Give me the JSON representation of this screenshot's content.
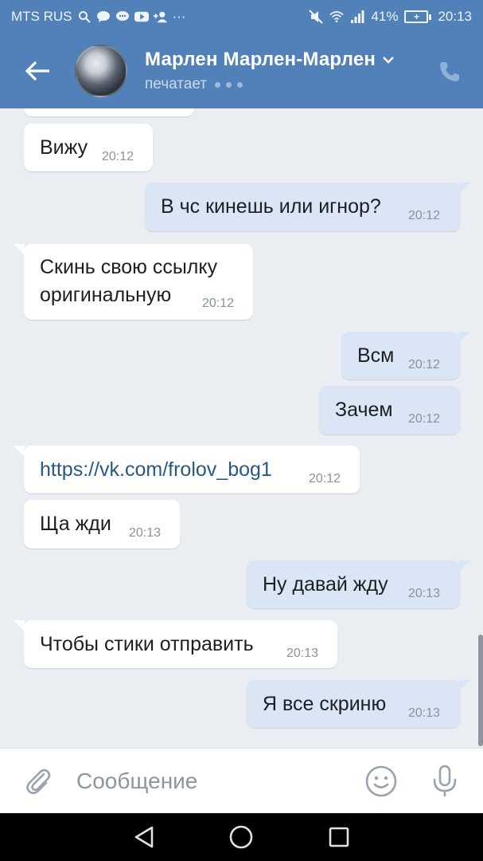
{
  "statusbar": {
    "carrier": "MTS RUS",
    "battery_percent": "41%",
    "battery_level": "+",
    "time": "20:13"
  },
  "header": {
    "name": "Марлен Марлен-Марлен",
    "status": "печатает"
  },
  "messages": [
    {
      "dir": "in",
      "text": "Вижу",
      "time": "20:12"
    },
    {
      "dir": "out",
      "text": "В чс кинешь или игнор?",
      "time": "20:12"
    },
    {
      "dir": "in",
      "line1": "Скинь свою ссылку",
      "line2": "оригинальную",
      "time": "20:12"
    },
    {
      "dir": "out",
      "text": "Всм",
      "time": "20:12"
    },
    {
      "dir": "out",
      "text": "Зачем",
      "time": "20:12"
    },
    {
      "dir": "in",
      "text": "https://vk.com/frolov_bog1",
      "time": "20:12",
      "is_link": true
    },
    {
      "dir": "in",
      "text": "Ща жди",
      "time": "20:13"
    },
    {
      "dir": "out",
      "text": "Ну давай жду",
      "time": "20:13"
    },
    {
      "dir": "in",
      "text": "Чтобы стики отправить",
      "time": "20:13"
    },
    {
      "dir": "out",
      "text": "Я все скриню",
      "time": "20:13"
    }
  ],
  "composer": {
    "placeholder": "Сообщение"
  },
  "icons": {
    "back": "arrow-left",
    "call": "phone",
    "attach": "paperclip",
    "emoji": "smiley",
    "mic": "microphone",
    "nav": [
      "back-triangle",
      "home-circle",
      "recents-square"
    ]
  },
  "colors": {
    "header_bg": "#5181b8",
    "chat_bg": "#eaedf2",
    "incoming_bubble": "#ffffff",
    "outgoing_bubble": "#dae6f5",
    "link": "#2a5885"
  }
}
